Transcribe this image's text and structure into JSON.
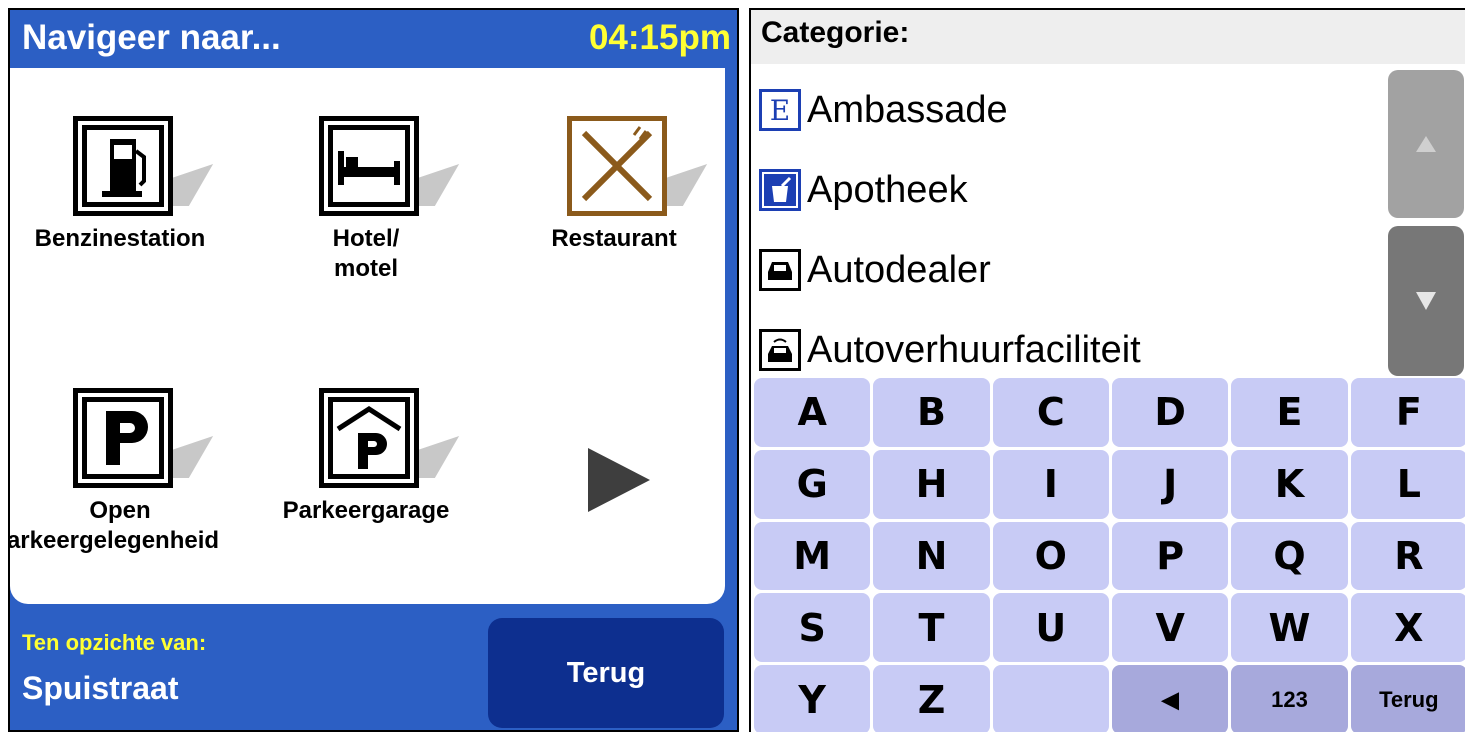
{
  "left": {
    "title": "Navigeer naar...",
    "clock": "04:15pm",
    "poi": [
      {
        "label1": "Benzinestation",
        "label2": "",
        "icon": "fuel-pump-icon"
      },
      {
        "label1": "Hotel/",
        "label2": "motel",
        "icon": "bed-icon"
      },
      {
        "label1": "Restaurant",
        "label2": "",
        "icon": "cutlery-icon"
      },
      {
        "label1": "Open",
        "label2": "Parkeergelegenheid",
        "icon": "parking-icon"
      },
      {
        "label1": "Parkeergarage",
        "label2": "",
        "icon": "parking-garage-icon"
      }
    ],
    "next_icon": "arrow-right-icon",
    "ref_label": "Ten opzichte van:",
    "ref_value": "Spuistraat",
    "back_label": "Terug"
  },
  "right": {
    "header": "Categorie:",
    "items": [
      {
        "label": "Ambassade",
        "icon": "embassy-icon",
        "glyph": "E"
      },
      {
        "label": "Apotheek",
        "icon": "pharmacy-icon",
        "glyph": ""
      },
      {
        "label": "Autodealer",
        "icon": "car-dealer-icon",
        "glyph": ""
      },
      {
        "label": "Autoverhuurfaciliteit",
        "icon": "car-rental-icon",
        "glyph": ""
      }
    ],
    "scroll_up_icon": "chevron-up-icon",
    "scroll_down_icon": "chevron-down-icon",
    "keys": [
      "A",
      "B",
      "C",
      "D",
      "E",
      "F",
      "G",
      "H",
      "I",
      "J",
      "K",
      "L",
      "M",
      "N",
      "O",
      "P",
      "Q",
      "R",
      "S",
      "T",
      "U",
      "V",
      "W",
      "X",
      "Y",
      "Z",
      "",
      "◀",
      "123",
      "Terug"
    ]
  },
  "colors": {
    "panel_blue": "#2c5fc4",
    "button_navy": "#0d2f8f",
    "clock_yellow": "#ffff33",
    "key_lavender": "#c8cbf5",
    "restaurant_brown": "#8b5a1b"
  }
}
